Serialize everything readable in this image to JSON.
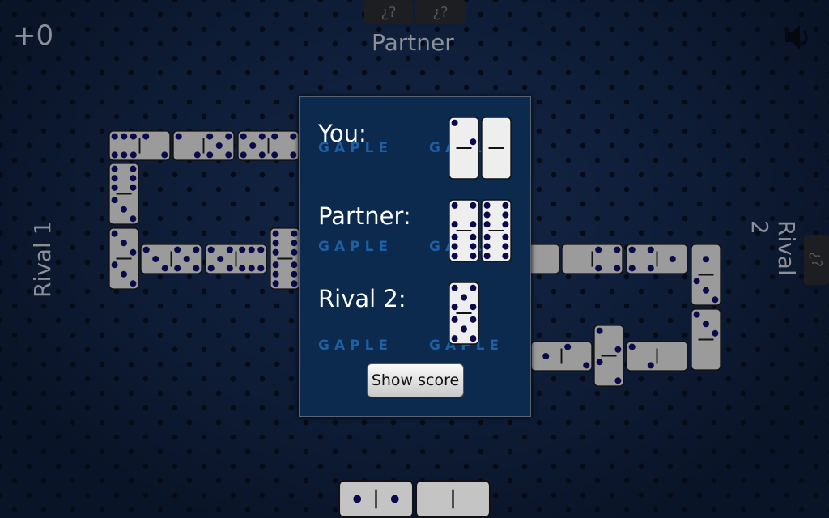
{
  "header": {
    "score": "+0",
    "partner_label": "Partner",
    "partner_hidden_tiles": [
      "¿?",
      "¿?"
    ],
    "sound_icon": "speaker-muted-icon"
  },
  "sides": {
    "rival1_label": "Rival 1",
    "rival2_label": "Rival 2",
    "rival2_hidden_tiles": [
      "¿?"
    ]
  },
  "board": {
    "tiles": [
      [
        6,
        2
      ],
      [
        2,
        5
      ],
      [
        5,
        4
      ],
      [
        6,
        3
      ],
      [
        3,
        3
      ],
      [
        3,
        5
      ],
      [
        5,
        6
      ],
      [
        6,
        6
      ],
      [
        0,
        0
      ],
      [
        0,
        4
      ],
      [
        4,
        1
      ],
      [
        1,
        3
      ],
      [
        3,
        0
      ],
      [
        1,
        2
      ],
      [
        2,
        2
      ],
      [
        2,
        0
      ]
    ]
  },
  "hand": {
    "tiles": [
      [
        1,
        1
      ],
      [
        0,
        0
      ]
    ]
  },
  "dialog": {
    "rows": [
      {
        "label": "You:",
        "tiles": [
          [
            2,
            0
          ],
          [
            0,
            0
          ]
        ]
      },
      {
        "label": "Partner:",
        "tiles": [
          [
            4,
            6
          ],
          [
            6,
            6
          ]
        ]
      },
      {
        "label": "Rival 2:",
        "tiles": [
          [
            5,
            5
          ]
        ]
      }
    ],
    "watermark": "GAPLE",
    "show_score_label": "Show score"
  },
  "colors": {
    "board_tile": "#9b9b9b",
    "hand_tile": "#c4c4c4",
    "dialog_tile": "#eeeeee",
    "pip": "#0a0a4a",
    "dialog_bg": "#0b2a4d"
  }
}
